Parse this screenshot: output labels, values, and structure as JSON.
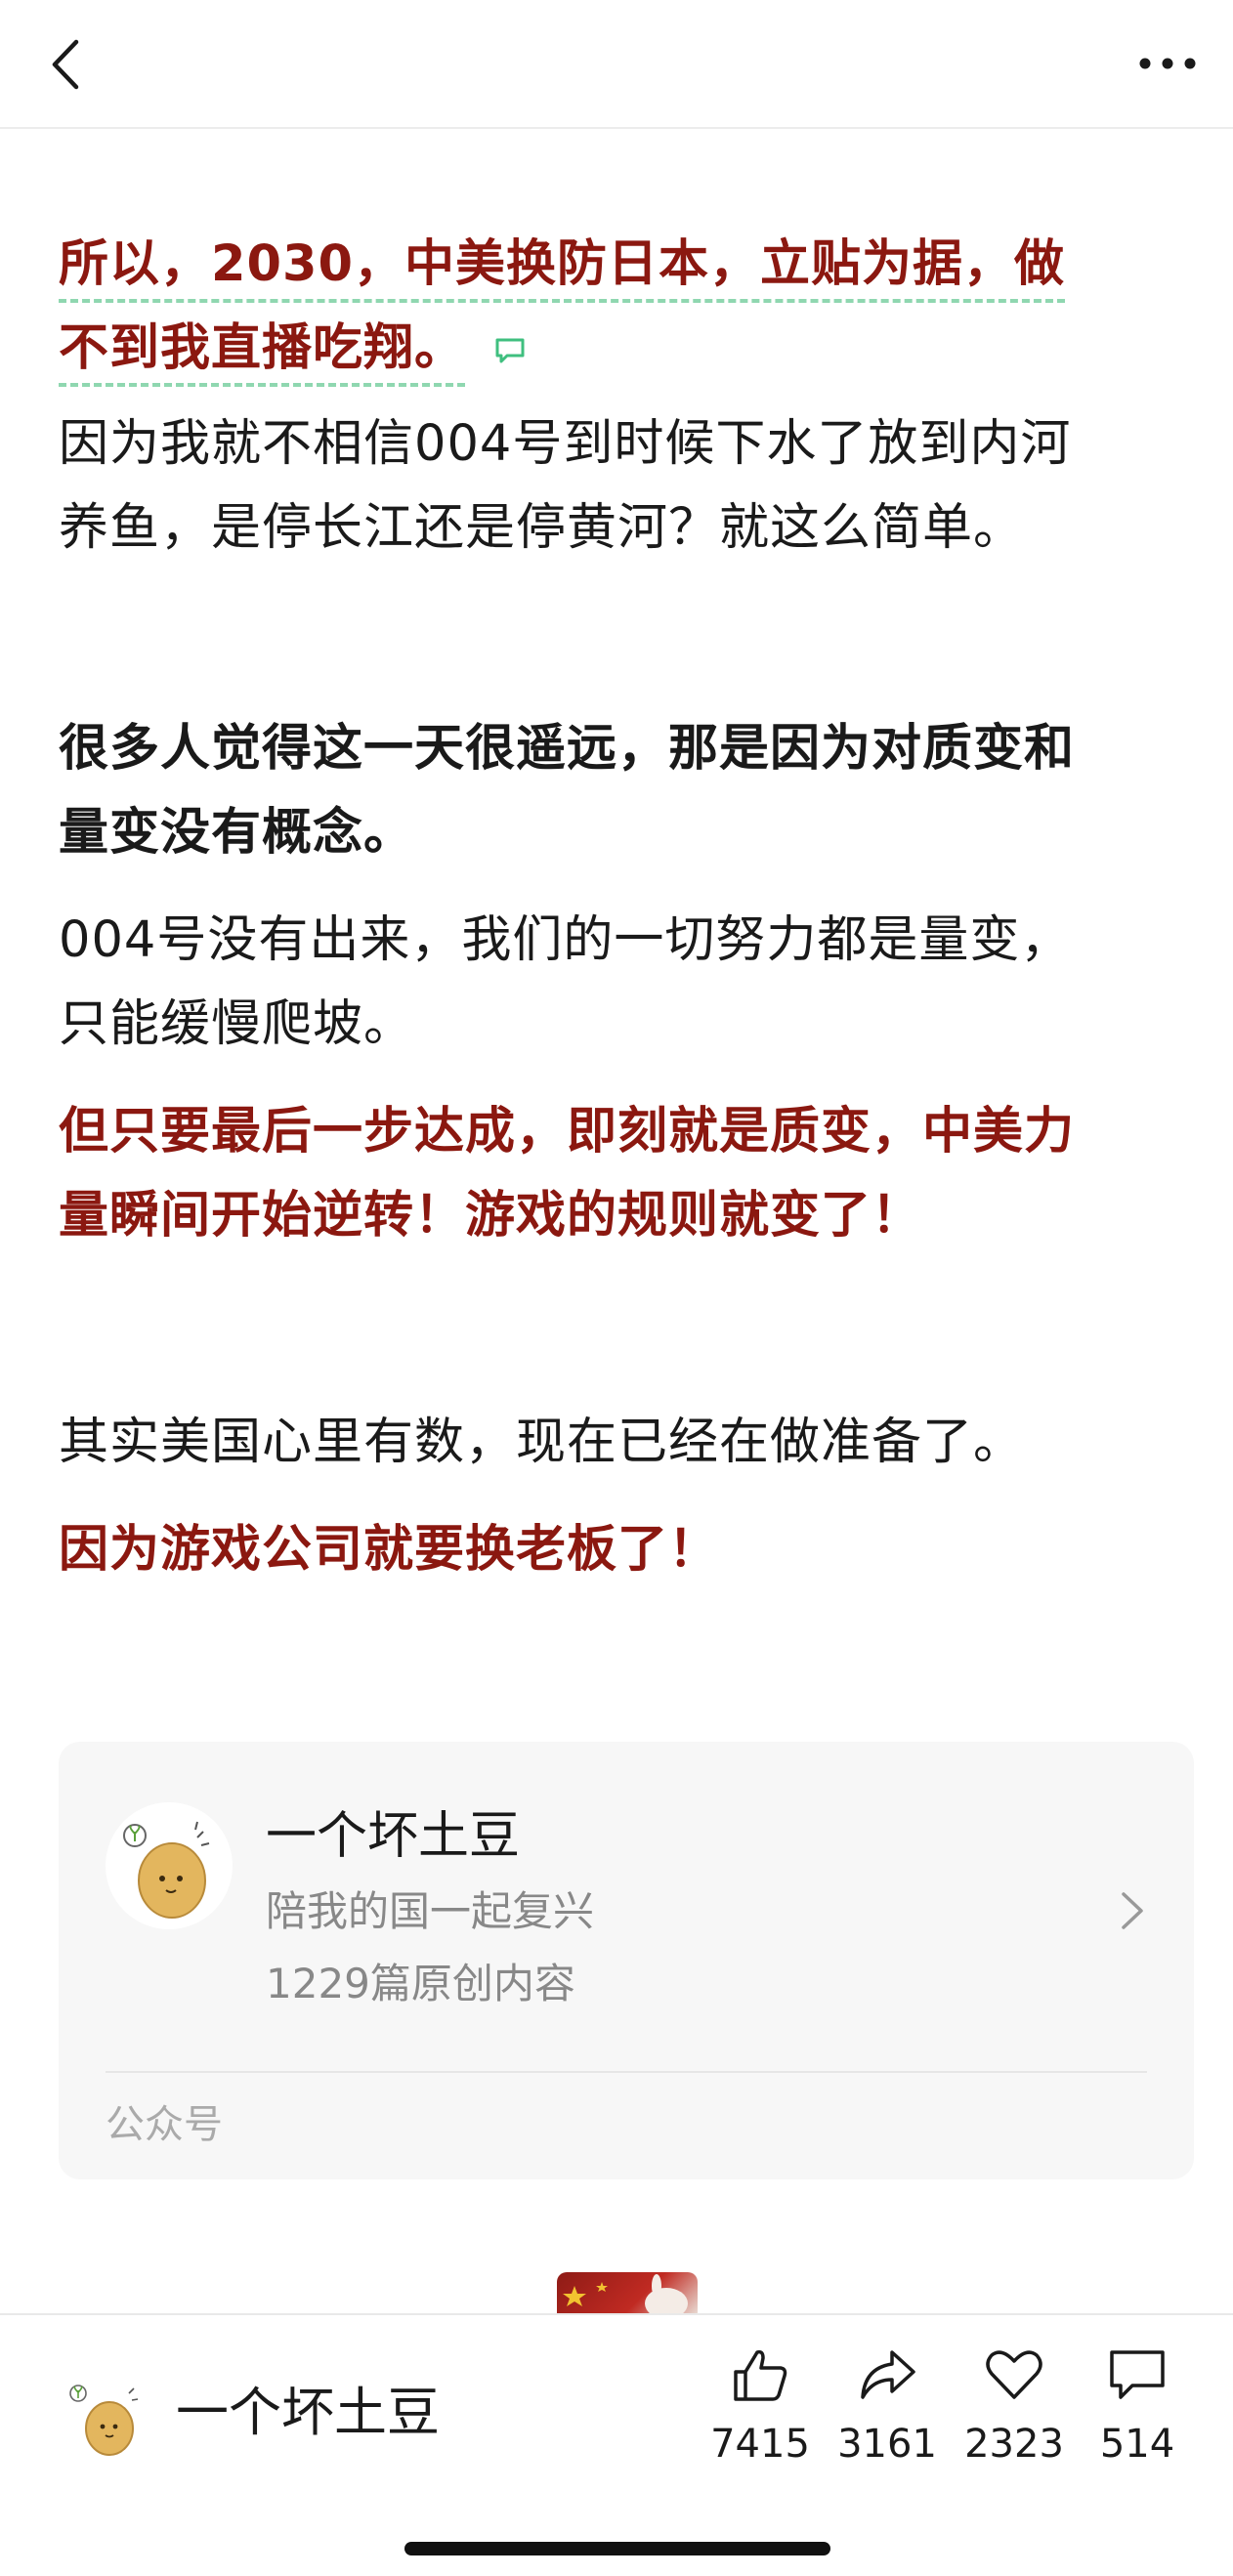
{
  "article": {
    "paragraphs": [
      {
        "style": "red-dashed",
        "lines": [
          "所以，2030，中美换防日本，立贴为据，做",
          "不到我直播吃翔。"
        ]
      },
      {
        "style": "normal",
        "lines": [
          "因为我就不相信004号到时候下水了放到内河",
          "养鱼，是停长江还是停黄河？就这么简单。"
        ]
      },
      {
        "style": "bold",
        "lines": [
          "很多人觉得这一天很遥远，那是因为对质变和",
          "量变没有概念。"
        ]
      },
      {
        "style": "normal",
        "lines": [
          "004号没有出来，我们的一切努力都是量变，",
          "只能缓慢爬坡。"
        ]
      },
      {
        "style": "red",
        "lines": [
          "但只要最后一步达成，即刻就是质变，中美力",
          "量瞬间开始逆转！游戏的规则就变了！"
        ]
      },
      {
        "style": "normal",
        "lines": [
          "其实美国心里有数，现在已经在做准备了。"
        ]
      },
      {
        "style": "red",
        "lines": [
          "因为游戏公司就要换老板了！"
        ]
      }
    ]
  },
  "profile_card": {
    "name": "一个坏土豆",
    "description": "陪我的国一起复兴",
    "article_count": "1229篇原创内容",
    "account_type": "公众号",
    "avatar_icon": "potato-avatar-icon"
  },
  "bottom_bar": {
    "author_name": "一个坏土豆",
    "actions": [
      {
        "icon": "thumbs-up-icon",
        "count": "7415"
      },
      {
        "icon": "share-icon",
        "count": "3161"
      },
      {
        "icon": "heart-icon",
        "count": "2323"
      },
      {
        "icon": "comment-icon",
        "count": "514"
      }
    ]
  },
  "colors": {
    "accent_red": "#8b1810",
    "dashed_underline": "#8fd7b0",
    "muted_text": "#888888"
  }
}
